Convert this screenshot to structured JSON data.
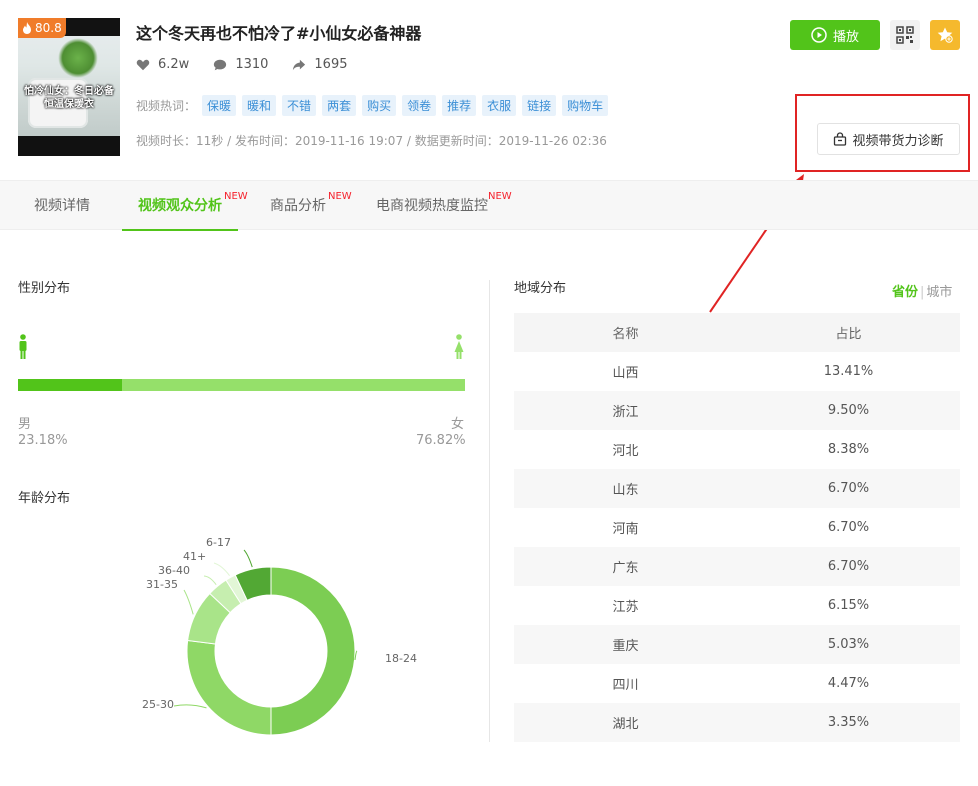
{
  "video": {
    "hot_score": "80.8",
    "thumb_caption_1": "怕冷仙女：冬日必备",
    "thumb_caption_2": "恒温保暖衣",
    "title": "这个冬天再也不怕冷了#小仙女必备神器",
    "likes": "6.2w",
    "comments": "1310",
    "shares": "1695",
    "tags_label": "视频热词：",
    "tags": [
      "保暖",
      "暖和",
      "不错",
      "两套",
      "购买",
      "领卷",
      "推荐",
      "衣服",
      "链接",
      "购物车"
    ],
    "meta": "视频时长：11秒 / 发布时间：2019-11-16 19:07 / 数据更新时间：2019-11-26 02:36"
  },
  "actions": {
    "play_label": "播放",
    "diagnose_label": "视频带货力诊断"
  },
  "tabs": [
    {
      "label": "视频详情",
      "new": ""
    },
    {
      "label": "视频观众分析",
      "new": "NEW"
    },
    {
      "label": "商品分析",
      "new": "NEW"
    },
    {
      "label": "电商视频热度监控",
      "new": "NEW"
    }
  ],
  "gender": {
    "title": "性别分布",
    "male_label": "男",
    "male_pct": "23.18%",
    "male_value": 23.18,
    "female_label": "女",
    "female_pct": "76.82%",
    "female_value": 76.82,
    "male_color": "#52c41a",
    "female_color": "#95e06a"
  },
  "age": {
    "title": "年龄分布"
  },
  "region": {
    "title": "地域分布",
    "switch_on": "省份",
    "switch_sep": "|",
    "switch_off": "城市",
    "col_name": "名称",
    "col_ratio": "占比",
    "rows": [
      {
        "name": "山西",
        "ratio": "13.41%"
      },
      {
        "name": "浙江",
        "ratio": "9.50%"
      },
      {
        "name": "河北",
        "ratio": "8.38%"
      },
      {
        "name": "山东",
        "ratio": "6.70%"
      },
      {
        "name": "河南",
        "ratio": "6.70%"
      },
      {
        "name": "广东",
        "ratio": "6.70%"
      },
      {
        "name": "江苏",
        "ratio": "6.15%"
      },
      {
        "name": "重庆",
        "ratio": "5.03%"
      },
      {
        "name": "四川",
        "ratio": "4.47%"
      },
      {
        "name": "湖北",
        "ratio": "3.35%"
      }
    ]
  },
  "chart_data": {
    "type": "pie",
    "title": "",
    "categories": [
      "18-24",
      "25-30",
      "31-35",
      "36-40",
      "41+",
      "6-17"
    ],
    "values": [
      50,
      27,
      10,
      4,
      2,
      7
    ],
    "colors": [
      "#7ccd53",
      "#8fd866",
      "#a9e489",
      "#c6eeaf",
      "#e2f6d6",
      "#52a834"
    ]
  }
}
